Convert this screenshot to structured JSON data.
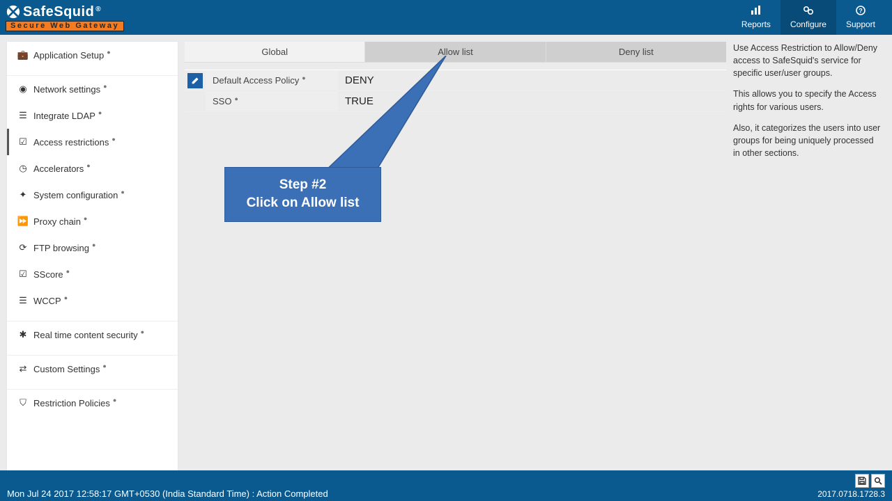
{
  "brand": {
    "name": "SafeSquid",
    "reg": "®",
    "tagline": "Secure Web Gateway"
  },
  "header_nav": [
    {
      "icon": "chart",
      "label": "Reports"
    },
    {
      "icon": "cogs",
      "label": "Configure"
    },
    {
      "icon": "help",
      "label": "Support"
    }
  ],
  "sidebar": {
    "groups": [
      [
        {
          "icon": "briefcase",
          "label": "Application Setup"
        }
      ],
      [
        {
          "icon": "globe",
          "label": "Network settings"
        },
        {
          "icon": "bars",
          "label": "Integrate LDAP"
        },
        {
          "icon": "check",
          "label": "Access restrictions",
          "active": true
        },
        {
          "icon": "gauge",
          "label": "Accelerators"
        },
        {
          "icon": "puzzle",
          "label": "System configuration"
        },
        {
          "icon": "forward",
          "label": "Proxy chain"
        },
        {
          "icon": "refresh",
          "label": "FTP browsing"
        },
        {
          "icon": "check",
          "label": "SScore"
        },
        {
          "icon": "bars",
          "label": "WCCP"
        }
      ],
      [
        {
          "icon": "bug",
          "label": "Real time content security"
        }
      ],
      [
        {
          "icon": "sliders",
          "label": "Custom Settings"
        }
      ],
      [
        {
          "icon": "shield",
          "label": "Restriction Policies"
        }
      ]
    ]
  },
  "tabs": [
    {
      "label": "Global",
      "style": "light"
    },
    {
      "label": "Allow list",
      "style": "dim"
    },
    {
      "label": "Deny list",
      "style": "dim"
    }
  ],
  "policy": [
    {
      "key": "Default Access Policy",
      "value": "DENY",
      "edit": true
    },
    {
      "key": "SSO",
      "value": "TRUE",
      "edit": false
    }
  ],
  "help": {
    "p1": "Use Access Restriction to Allow/Deny access to SafeSquid's service for specific user/user groups.",
    "p2": "This allows you to specify the Access rights for various users.",
    "p3": "Also, it categorizes the users into user groups for being uniquely processed in other sections."
  },
  "callout": {
    "line1": "Step #2",
    "line2": "Click on Allow list"
  },
  "footer": {
    "status": "Mon Jul 24 2017 12:58:17 GMT+0530 (India Standard Time) : Action Completed",
    "version": "2017.0718.1728.3"
  }
}
